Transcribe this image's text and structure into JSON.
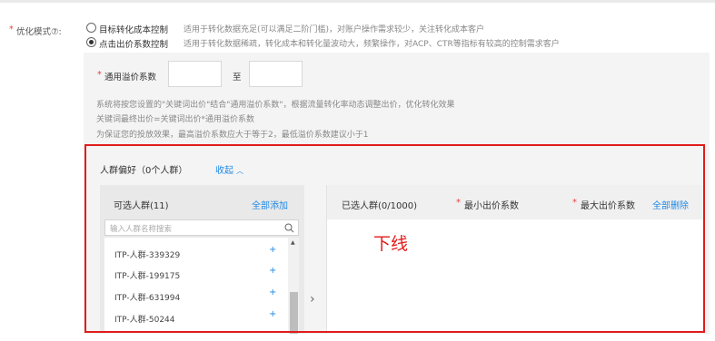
{
  "mode": {
    "label": "优化模式⑦:",
    "options": [
      {
        "title": "目标转化成本控制",
        "desc": "适用于转化数据充足(可以满足二阶门槛)，对账户操作需求较少，关注转化成本客户",
        "selected": false
      },
      {
        "title": "点击出价系数控制",
        "desc": "适用于转化数据稀疏，转化成本和转化量波动大，频繁操作，对ACP、CTR等指标有较高的控制需求客户",
        "selected": true
      }
    ]
  },
  "premium": {
    "label": "通用溢价系数",
    "to": "至",
    "notes": [
      "系统将按您设置的\"关键词出价\"结合\"通用溢价系数\"，根据流量转化率动态调整出价，优化转化效果",
      "关键词最终出价=关键词出价*通用溢价系数",
      "为保证您的投放效果，最高溢价系数应大于等于2，最低溢价系数建议小于1"
    ]
  },
  "crowd": {
    "title": "人群偏好（0个人群）",
    "collapse": "收起",
    "collapse_icon": "chevron-up-icon",
    "available_title": "可选人群(11)",
    "add_all": "全部添加",
    "search_placeholder": "输入人群名称搜索",
    "items": [
      "ITP-人群-339329",
      "ITP-人群-199175",
      "ITP-人群-631994",
      "ITP-人群-50244"
    ],
    "item_action": "+",
    "transfer_arrow": "›",
    "selected_title": "已选人群(0/1000)",
    "min_bid": "最小出价系数",
    "max_bid": "最大出价系数",
    "delete_all": "全部删除"
  },
  "annotation": "下线",
  "colors": {
    "required": "#e8423b",
    "link": "#1e88e5",
    "highlight": "#e21b1b"
  }
}
